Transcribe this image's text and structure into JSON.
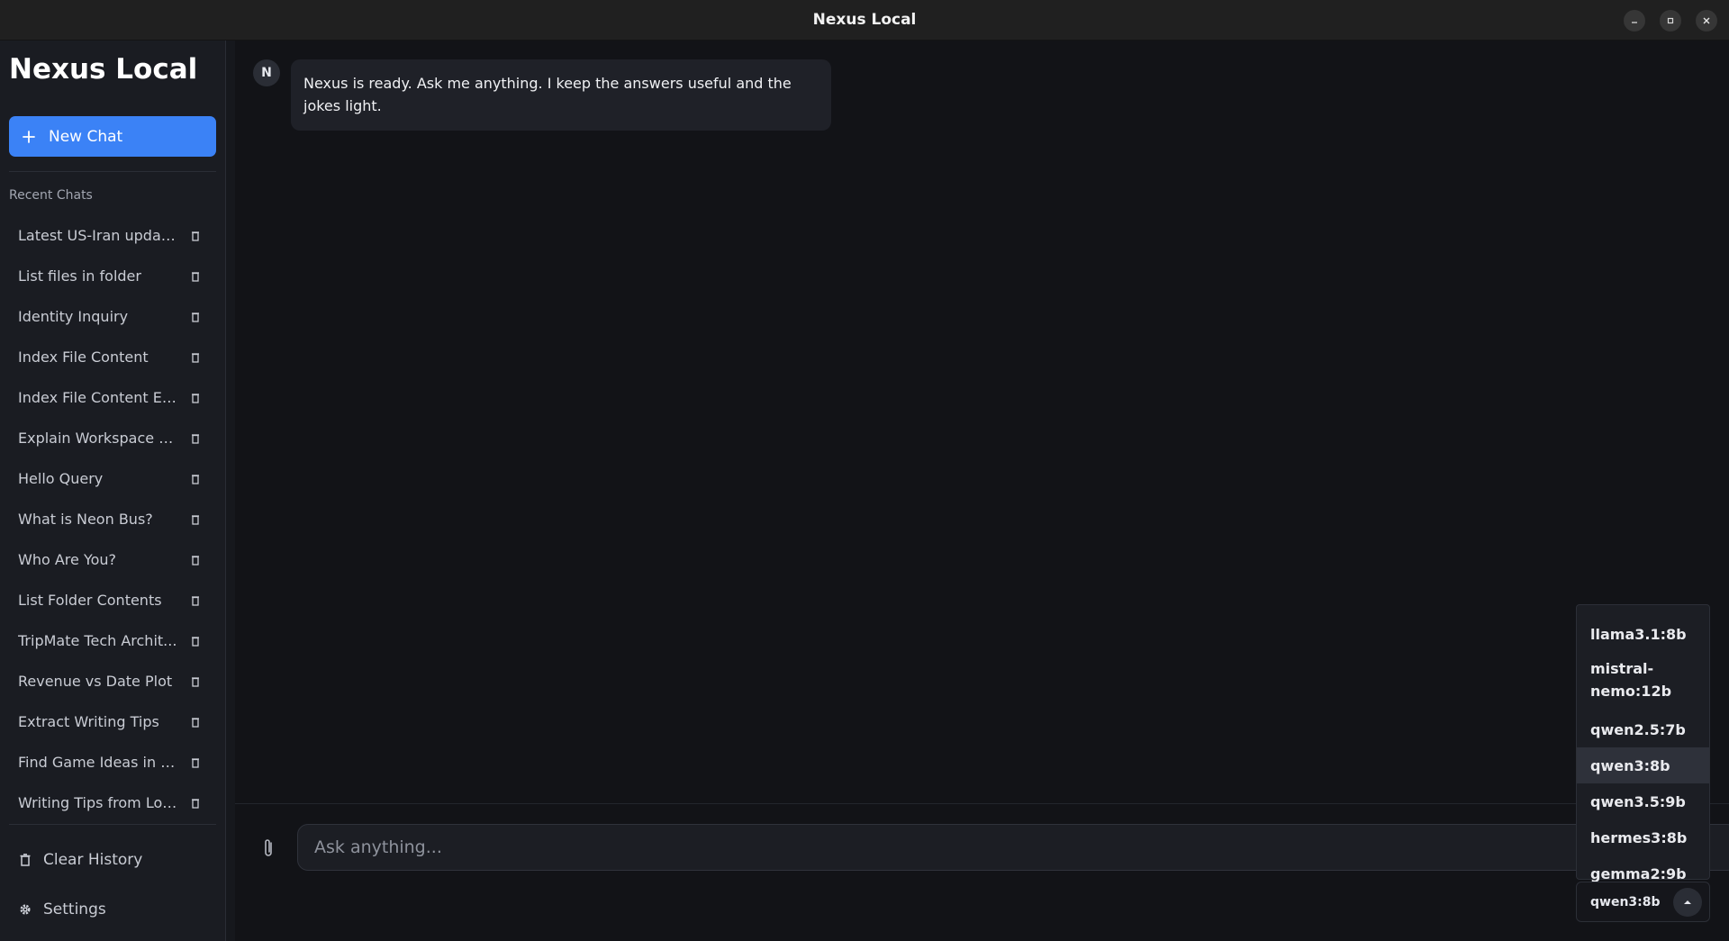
{
  "window": {
    "title": "Nexus Local"
  },
  "sidebar": {
    "brand": "Nexus Local",
    "new_chat_label": "New Chat",
    "recent_label": "Recent Chats",
    "chats": [
      {
        "label": "Latest US-Iran updat..."
      },
      {
        "label": "List files in folder"
      },
      {
        "label": "Identity Inquiry"
      },
      {
        "label": "Index File Content"
      },
      {
        "label": "Index File Content Ex..."
      },
      {
        "label": "Explain Workspace C..."
      },
      {
        "label": "Hello Query"
      },
      {
        "label": "What is Neon Bus?"
      },
      {
        "label": "Who Are You?"
      },
      {
        "label": "List Folder Contents"
      },
      {
        "label": "TripMate Tech Archit..."
      },
      {
        "label": "Revenue vs Date Plot"
      },
      {
        "label": "Extract Writing Tips"
      },
      {
        "label": "Find Game Ideas in Fi..."
      },
      {
        "label": "Writing Tips from Loc..."
      }
    ],
    "clear_history_label": "Clear History",
    "settings_label": "Settings"
  },
  "conversation": {
    "assistant_initial": "N",
    "welcome_message": "Nexus is ready. Ask me anything. I keep the answers useful and the jokes light."
  },
  "composer": {
    "placeholder": "Ask anything..."
  },
  "model_picker": {
    "selected": "qwen3:8b",
    "options": [
      "llama3.1:8b",
      "mistral-nemo:12b",
      "qwen2.5:7b",
      "qwen3:8b",
      "qwen3.5:9b",
      "hermes3:8b",
      "gemma2:9b"
    ]
  },
  "icons": {
    "new_chat": "plus-icon",
    "delete": "trash-icon",
    "clear": "trash-icon",
    "settings": "gear-icon",
    "attach": "paperclip-icon",
    "dropdown": "chevron-up-icon"
  },
  "colors": {
    "accent": "#3b82f6",
    "background": "#121317",
    "sidebar": "#1a1c22"
  }
}
